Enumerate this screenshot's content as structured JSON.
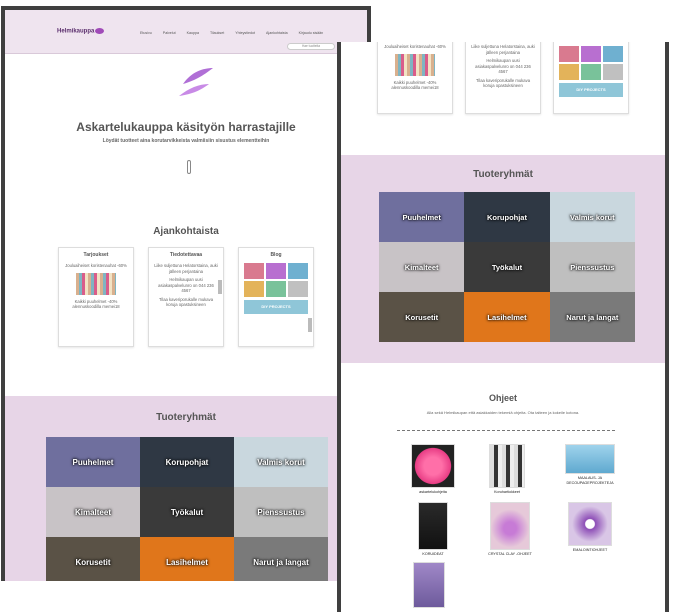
{
  "site": {
    "logo": "Helmikauppa",
    "nav": [
      "Etusivu",
      "Palvelut",
      "Kauppa",
      "Tilaukset",
      "Yhteystiedot",
      "Ajankohtaista",
      "Kirjaudu sisään"
    ],
    "search_placeholder": "Hae tuotteita"
  },
  "hero": {
    "title": "Askartelukauppa käsityön harrastajille",
    "subtitle": "Löydät tuotteet aina korutarvikkeista valmiisiin sisustus elementteihin"
  },
  "current": {
    "title": "Ajankohtaista",
    "cards": [
      {
        "title": "Tarjoukset",
        "lines": [
          "Jouluaiheiset koristenauhat -60%",
          "Kaikki puuhelmet -40% alennuskoodilla memei18"
        ]
      },
      {
        "title": "Tiedotettavaa",
        "lines": [
          "Liike suljettuna Helatorstaina, auki jälleen perjantaina",
          "Helmikaupan uusi asiakaspalvelunro on 044 236 4567",
          "Tilaa kaveriporukalle mukava koruja opastuksineen"
        ]
      },
      {
        "title": "Blog",
        "lines": [
          "DIY PROJECTS"
        ]
      }
    ],
    "right_snippet": {
      "col1": [
        "Jouluaiheiset koristenauhat -60%",
        "Kaikki puuhelmet -40% alennuskoodilla memei18"
      ],
      "col2": [
        "Liike suljettuna Helatorstaina, auki jälleen perjantaina",
        "Helmikaupan uusi asiakaspalvelunro on 044 236 4567",
        "Tilaa kaveriporukalle mukava koruja opastuksineen"
      ],
      "col3": "DIY PROJECTS"
    }
  },
  "groups": {
    "title": "Tuoteryhmät",
    "tiles": [
      "Puuhelmet",
      "Korupohjat",
      "Valmis korut",
      "Kimalteet",
      "Työkalut",
      "Pienssustus",
      "Korusetit",
      "Lasihelmet",
      "Narut ja langat"
    ],
    "right_tiles": [
      "Puuhelmet",
      "Korupohjat",
      "Valmis korut",
      "Kimalteet",
      "Työkalut",
      "Pienssustus",
      "Korusetit",
      "Lasihelmet",
      "Narut ja langat"
    ],
    "colors": [
      "#6f6f9e",
      "#2f3844",
      "#c9d7de",
      "#c8c3c6",
      "#3a3a3a",
      "#bfbfbf",
      "#5a5246",
      "#e0761b",
      "#7a7a7a"
    ]
  },
  "guides": {
    "title": "Ohjeet",
    "intro": "Alla sekä Helmikaupan että asiakkaiden tekemiä ohjeita. Ota talteen ja kokeile kotona.",
    "items": [
      "askartelukohjeita",
      "Koruhartiokkeet",
      "MAALAUS- JA DECOUPAGEPROJEKTEJA",
      "KORUIDEAT",
      "CRYSTAL CLAY -OHJEET",
      "EMALOINTIOHJEET",
      ""
    ]
  }
}
